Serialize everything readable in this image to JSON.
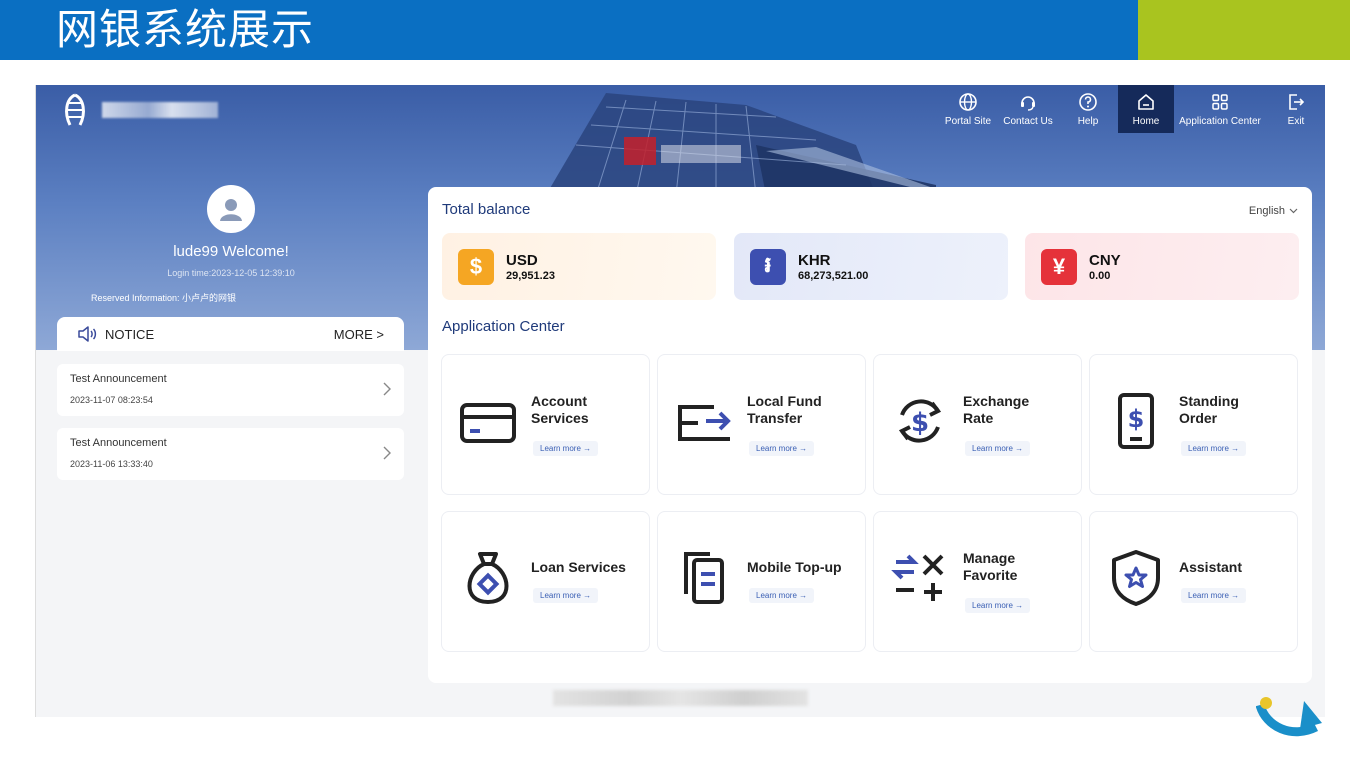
{
  "slide": {
    "title": "网银系统展示",
    "colors": {
      "banner": "#0a6fc2",
      "accent": "#a9c41f"
    }
  },
  "nav": {
    "items": [
      {
        "label": "Portal Site",
        "icon": "globe-icon"
      },
      {
        "label": "Contact Us",
        "icon": "headset-icon"
      },
      {
        "label": "Help",
        "icon": "help-icon"
      },
      {
        "label": "Home",
        "icon": "home-icon",
        "active": true
      },
      {
        "label": "Application Center",
        "icon": "grid-icon"
      },
      {
        "label": "Exit",
        "icon": "exit-icon"
      }
    ]
  },
  "user": {
    "welcome": "lude99 Welcome!",
    "login_time": "Login time:2023-12-05 12:39:10",
    "reserved": "Reserved Information: 小卢卢的网银"
  },
  "notice": {
    "label": "NOTICE",
    "more": "MORE >",
    "items": [
      {
        "title": "Test Announcement",
        "date": "2023-11-07 08:23:54"
      },
      {
        "title": "Test Announcement",
        "date": "2023-11-06 13:33:40"
      }
    ]
  },
  "balance": {
    "title": "Total balance",
    "language": "English",
    "accounts": [
      {
        "currency": "USD",
        "amount": "29,951.23",
        "symbol": "$",
        "color": "#f5a623",
        "bg": "#fff3e6",
        "icon": "dollar-icon"
      },
      {
        "currency": "KHR",
        "amount": "68,273,521.00",
        "symbol": "៛",
        "color": "#3d4fb0",
        "bg": "#e6ebf9",
        "icon": "riel-icon"
      },
      {
        "currency": "CNY",
        "amount": "0.00",
        "symbol": "¥",
        "color": "#e5323a",
        "bg": "#fde8ea",
        "icon": "yuan-icon"
      }
    ]
  },
  "apps": {
    "title": "Application Center",
    "learn_more": "Learn more →",
    "items": [
      {
        "line1": "Account",
        "line2": "Services",
        "icon": "card-icon"
      },
      {
        "line1": "Local Fund",
        "line2": "Transfer",
        "icon": "transfer-icon"
      },
      {
        "line1": "Exchange",
        "line2": "Rate",
        "icon": "exchange-icon"
      },
      {
        "line1": "Standing",
        "line2": "Order",
        "icon": "phone-dollar-icon"
      },
      {
        "line1": "Loan Services",
        "line2": "",
        "icon": "moneybag-icon"
      },
      {
        "line1": "Mobile Top-up",
        "line2": "",
        "icon": "documents-icon"
      },
      {
        "line1": "Manage",
        "line2": "Favorite",
        "icon": "calculator-icon"
      },
      {
        "line1": "Assistant",
        "line2": "",
        "icon": "shield-star-icon"
      }
    ]
  }
}
